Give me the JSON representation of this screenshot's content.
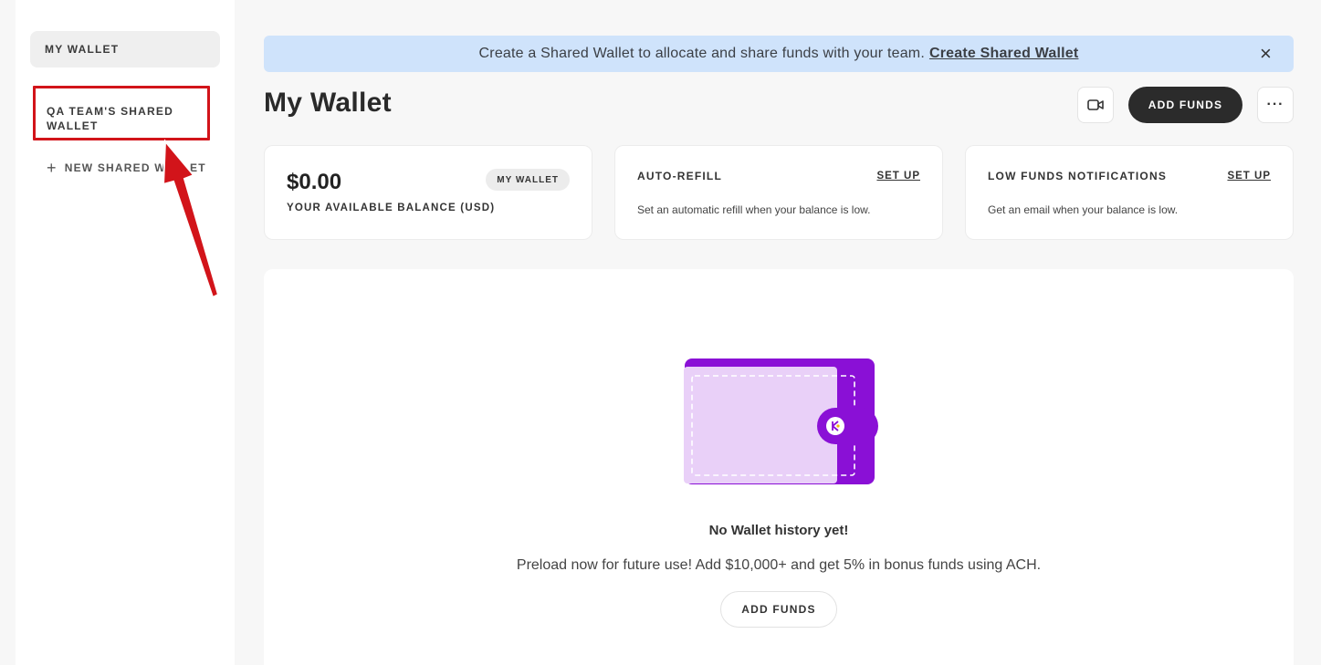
{
  "sidebar": {
    "my_wallet": "MY WALLET",
    "shared_wallet": "QA TEAM'S SHARED WALLET",
    "new_shared_wallet": "NEW SHARED WALLET"
  },
  "banner": {
    "text": "Create a Shared Wallet to allocate and share funds with your team.",
    "link": "Create Shared Wallet",
    "close": "×"
  },
  "header": {
    "title": "My Wallet",
    "add_funds": "ADD FUNDS",
    "more": "···"
  },
  "cards": {
    "balance": {
      "amount": "$0.00",
      "label": "YOUR AVAILABLE BALANCE (USD)",
      "badge": "MY WALLET"
    },
    "auto_refill": {
      "title": "AUTO-REFILL",
      "link": "SET UP",
      "desc": "Set an automatic refill when your balance is low."
    },
    "low_funds": {
      "title": "LOW FUNDS NOTIFICATIONS",
      "link": "SET UP",
      "desc": "Get an email when your balance is low."
    }
  },
  "history": {
    "empty_title": "No Wallet history yet!",
    "empty_desc": "Preload now for future use! Add $10,000+ and get 5% in bonus funds using ACH.",
    "add_funds": "ADD FUNDS"
  },
  "colors": {
    "annotation": "#d2141a",
    "banner_bg": "#cfe3fb",
    "wallet_purple": "#8a10d6",
    "wallet_light": "#e9d0f8"
  }
}
